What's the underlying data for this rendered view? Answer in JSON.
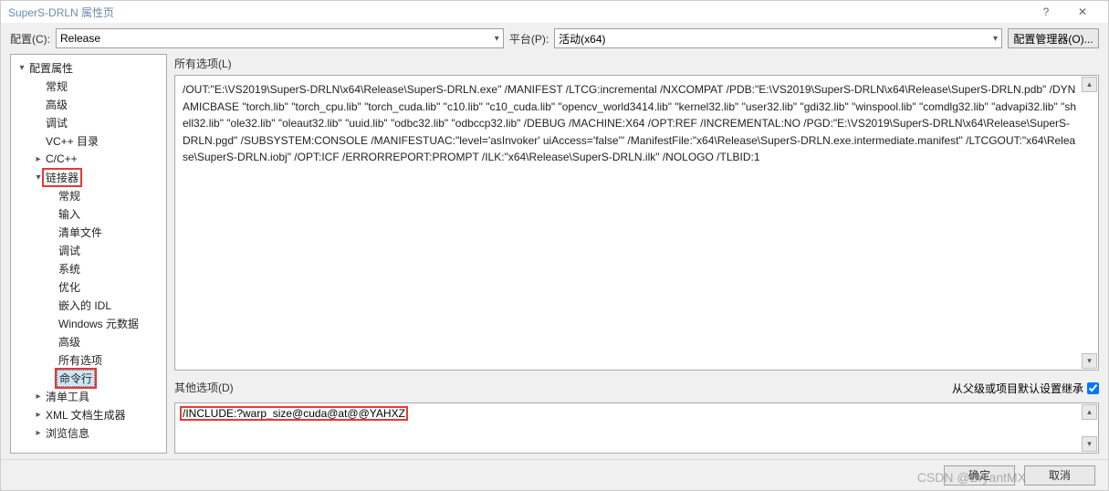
{
  "window": {
    "title": "SuperS-DRLN 属性页",
    "help_glyph": "?",
    "close_glyph": "✕"
  },
  "topbar": {
    "config_label": "配置(C):",
    "config_value": "Release",
    "platform_label": "平台(P):",
    "platform_value": "活动(x64)",
    "config_manager": "配置管理器(O)..."
  },
  "tree": {
    "items": [
      {
        "label": "配置属性",
        "depth": 0,
        "exp": "▾"
      },
      {
        "label": "常规",
        "depth": 1,
        "exp": ""
      },
      {
        "label": "高级",
        "depth": 1,
        "exp": ""
      },
      {
        "label": "调试",
        "depth": 1,
        "exp": ""
      },
      {
        "label": "VC++ 目录",
        "depth": 1,
        "exp": ""
      },
      {
        "label": "C/C++",
        "depth": 1,
        "exp": "▸"
      },
      {
        "label": "链接器",
        "depth": 1,
        "exp": "▾",
        "hl": true
      },
      {
        "label": "常规",
        "depth": 2,
        "exp": ""
      },
      {
        "label": "输入",
        "depth": 2,
        "exp": ""
      },
      {
        "label": "清单文件",
        "depth": 2,
        "exp": ""
      },
      {
        "label": "调试",
        "depth": 2,
        "exp": ""
      },
      {
        "label": "系统",
        "depth": 2,
        "exp": ""
      },
      {
        "label": "优化",
        "depth": 2,
        "exp": ""
      },
      {
        "label": "嵌入的 IDL",
        "depth": 2,
        "exp": ""
      },
      {
        "label": "Windows 元数据",
        "depth": 2,
        "exp": ""
      },
      {
        "label": "高级",
        "depth": 2,
        "exp": ""
      },
      {
        "label": "所有选项",
        "depth": 2,
        "exp": ""
      },
      {
        "label": "命令行",
        "depth": 2,
        "exp": "",
        "hl": true,
        "sel": true
      },
      {
        "label": "清单工具",
        "depth": 1,
        "exp": "▸"
      },
      {
        "label": "XML 文档生成器",
        "depth": 1,
        "exp": "▸"
      },
      {
        "label": "浏览信息",
        "depth": 1,
        "exp": "▸"
      }
    ]
  },
  "main": {
    "all_options_label": "所有选项(L)",
    "all_options_text": "/OUT:\"E:\\VS2019\\SuperS-DRLN\\x64\\Release\\SuperS-DRLN.exe\" /MANIFEST /LTCG:incremental /NXCOMPAT /PDB:\"E:\\VS2019\\SuperS-DRLN\\x64\\Release\\SuperS-DRLN.pdb\" /DYNAMICBASE \"torch.lib\" \"torch_cpu.lib\" \"torch_cuda.lib\" \"c10.lib\" \"c10_cuda.lib\" \"opencv_world3414.lib\" \"kernel32.lib\" \"user32.lib\" \"gdi32.lib\" \"winspool.lib\" \"comdlg32.lib\" \"advapi32.lib\" \"shell32.lib\" \"ole32.lib\" \"oleaut32.lib\" \"uuid.lib\" \"odbc32.lib\" \"odbccp32.lib\" /DEBUG /MACHINE:X64 /OPT:REF /INCREMENTAL:NO /PGD:\"E:\\VS2019\\SuperS-DRLN\\x64\\Release\\SuperS-DRLN.pgd\" /SUBSYSTEM:CONSOLE /MANIFESTUAC:\"level='asInvoker' uiAccess='false'\" /ManifestFile:\"x64\\Release\\SuperS-DRLN.exe.intermediate.manifest\" /LTCGOUT:\"x64\\Release\\SuperS-DRLN.iobj\" /OPT:ICF /ERRORREPORT:PROMPT /ILK:\"x64\\Release\\SuperS-DRLN.ilk\" /NOLOGO /TLBID:1",
    "inherit_label": "从父级或项目默认设置继承",
    "other_label": "其他选项(D)",
    "other_value": "/INCLUDE:?warp_size@cuda@at@@YAHXZ"
  },
  "footer": {
    "ok": "确定",
    "cancel": "取消",
    "watermark": "CSDN @BryantMX"
  }
}
